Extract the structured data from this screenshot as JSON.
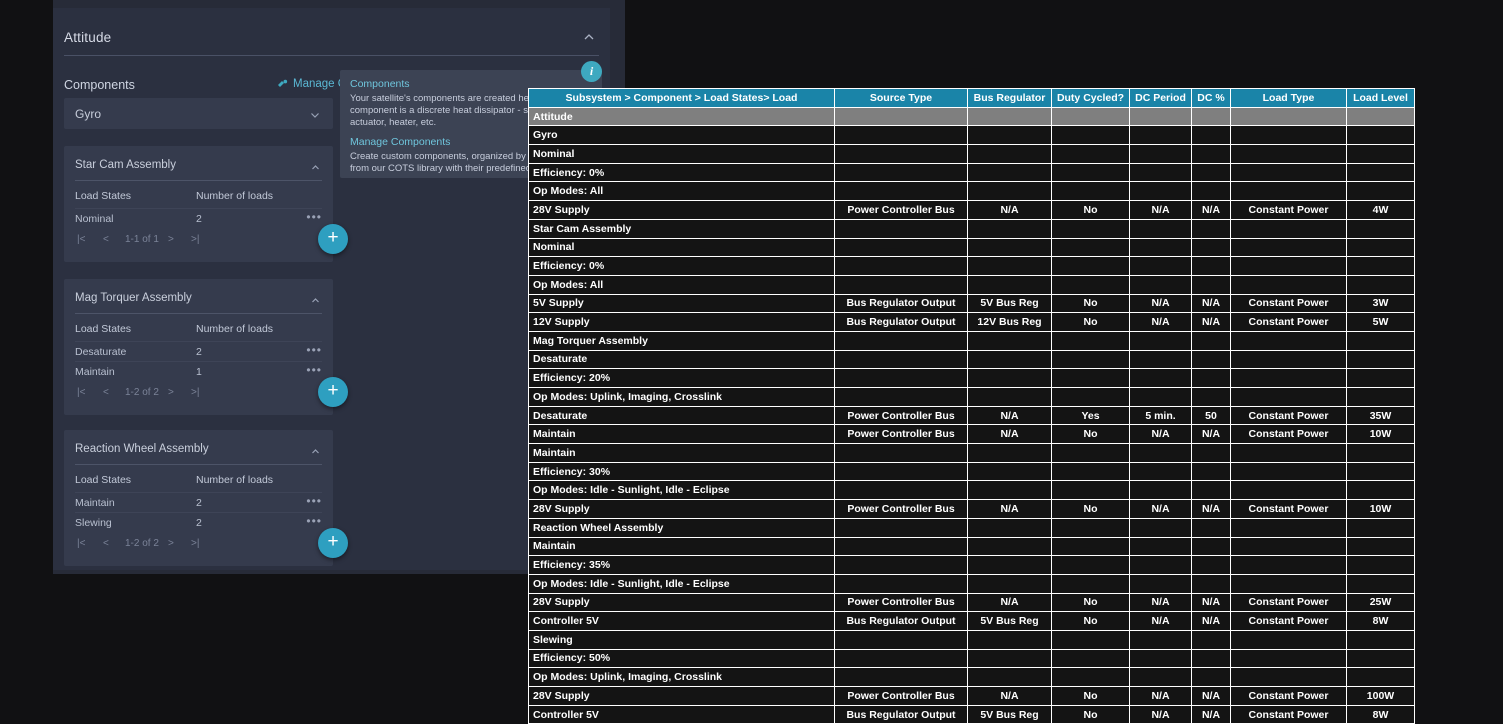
{
  "app": {
    "section_title": "Attitude",
    "components_label": "Components",
    "manage_components_link": "Manage Components",
    "selected_component": "Gyro",
    "load_states_header": "Load States",
    "number_of_loads_header": "Number of loads",
    "pager_first": "|<",
    "pager_prev": "<",
    "pager_next": ">",
    "pager_last": ">|",
    "add_label": "+",
    "more_label": "•••",
    "accent_color": "#2e9fc0",
    "link_color": "#5bb8d4",
    "assemblies": [
      {
        "title": "Star Cam Assembly",
        "pager_text": "1-1 of 1",
        "rows": [
          {
            "state": "Nominal",
            "loads": "2"
          }
        ]
      },
      {
        "title": "Mag Torquer Assembly",
        "pager_text": "1-2 of 2",
        "rows": [
          {
            "state": "Desaturate",
            "loads": "2"
          },
          {
            "state": "Maintain",
            "loads": "1"
          }
        ]
      },
      {
        "title": "Reaction Wheel Assembly",
        "pager_text": "1-2 of 2",
        "rows": [
          {
            "state": "Maintain",
            "loads": "2"
          },
          {
            "state": "Slewing",
            "loads": "2"
          }
        ]
      }
    ]
  },
  "tooltip": {
    "heading_1": "Components",
    "body_1": "Your satellite's components are created here. In Seda component is a discrete heat dissipator - such as a fl actuator, heater, etc.",
    "heading_2": "Manage Components",
    "body_2": "Create custom components, organized by subsystem from our COTS library with their predefined loads an"
  },
  "info_icon": {
    "glyph": "i"
  },
  "sheet": {
    "header_bg": "#1a84a8",
    "group_bg": "#7f7f7f",
    "columns": [
      "Subsystem > Component > Load States> Load",
      "Source Type",
      "Bus Regulator",
      "Duty Cycled?",
      "DC Period",
      "DC %",
      "Load Type",
      "Load Level"
    ],
    "rows": [
      {
        "group": true,
        "cells": [
          "Attitude",
          "",
          "",
          "",
          "",
          "",
          "",
          ""
        ]
      },
      {
        "group": false,
        "cells": [
          "Gyro",
          "",
          "",
          "",
          "",
          "",
          "",
          ""
        ]
      },
      {
        "group": false,
        "cells": [
          "Nominal",
          "",
          "",
          "",
          "",
          "",
          "",
          ""
        ]
      },
      {
        "group": false,
        "cells": [
          "Efficiency: 0%",
          "",
          "",
          "",
          "",
          "",
          "",
          ""
        ]
      },
      {
        "group": false,
        "cells": [
          "Op Modes: All",
          "",
          "",
          "",
          "",
          "",
          "",
          ""
        ]
      },
      {
        "group": false,
        "cells": [
          "28V Supply",
          "Power Controller Bus",
          "N/A",
          "No",
          "N/A",
          "N/A",
          "Constant Power",
          "4W"
        ]
      },
      {
        "group": false,
        "cells": [
          "Star Cam Assembly",
          "",
          "",
          "",
          "",
          "",
          "",
          ""
        ]
      },
      {
        "group": false,
        "cells": [
          "Nominal",
          "",
          "",
          "",
          "",
          "",
          "",
          ""
        ]
      },
      {
        "group": false,
        "cells": [
          "Efficiency: 0%",
          "",
          "",
          "",
          "",
          "",
          "",
          ""
        ]
      },
      {
        "group": false,
        "cells": [
          "Op Modes: All",
          "",
          "",
          "",
          "",
          "",
          "",
          ""
        ]
      },
      {
        "group": false,
        "cells": [
          "5V Supply",
          "Bus Regulator Output",
          "5V Bus Reg",
          "No",
          "N/A",
          "N/A",
          "Constant Power",
          "3W"
        ]
      },
      {
        "group": false,
        "cells": [
          "12V Supply",
          "Bus Regulator Output",
          "12V Bus Reg",
          "No",
          "N/A",
          "N/A",
          "Constant Power",
          "5W"
        ]
      },
      {
        "group": false,
        "cells": [
          "Mag Torquer Assembly",
          "",
          "",
          "",
          "",
          "",
          "",
          ""
        ]
      },
      {
        "group": false,
        "cells": [
          "Desaturate",
          "",
          "",
          "",
          "",
          "",
          "",
          ""
        ]
      },
      {
        "group": false,
        "cells": [
          "Efficiency: 20%",
          "",
          "",
          "",
          "",
          "",
          "",
          ""
        ]
      },
      {
        "group": false,
        "cells": [
          "Op Modes: Uplink, Imaging, Crosslink",
          "",
          "",
          "",
          "",
          "",
          "",
          ""
        ]
      },
      {
        "group": false,
        "cells": [
          "Desaturate",
          "Power Controller Bus",
          "N/A",
          "Yes",
          "5 min.",
          "50",
          "Constant Power",
          "35W"
        ]
      },
      {
        "group": false,
        "cells": [
          "Maintain",
          "Power Controller Bus",
          "N/A",
          "No",
          "N/A",
          "N/A",
          "Constant Power",
          "10W"
        ]
      },
      {
        "group": false,
        "cells": [
          "Maintain",
          "",
          "",
          "",
          "",
          "",
          "",
          ""
        ]
      },
      {
        "group": false,
        "cells": [
          "Efficiency: 30%",
          "",
          "",
          "",
          "",
          "",
          "",
          ""
        ]
      },
      {
        "group": false,
        "cells": [
          "Op Modes: Idle - Sunlight, Idle - Eclipse",
          "",
          "",
          "",
          "",
          "",
          "",
          ""
        ]
      },
      {
        "group": false,
        "cells": [
          "28V Supply",
          "Power Controller Bus",
          "N/A",
          "No",
          "N/A",
          "N/A",
          "Constant Power",
          "10W"
        ]
      },
      {
        "group": false,
        "cells": [
          "Reaction Wheel Assembly",
          "",
          "",
          "",
          "",
          "",
          "",
          ""
        ]
      },
      {
        "group": false,
        "cells": [
          "Maintain",
          "",
          "",
          "",
          "",
          "",
          "",
          ""
        ]
      },
      {
        "group": false,
        "cells": [
          "Efficiency: 35%",
          "",
          "",
          "",
          "",
          "",
          "",
          ""
        ]
      },
      {
        "group": false,
        "cells": [
          "Op Modes: Idle - Sunlight, Idle - Eclipse",
          "",
          "",
          "",
          "",
          "",
          "",
          ""
        ]
      },
      {
        "group": false,
        "cells": [
          "28V Supply",
          "Power Controller Bus",
          "N/A",
          "No",
          "N/A",
          "N/A",
          "Constant Power",
          "25W"
        ]
      },
      {
        "group": false,
        "cells": [
          "Controller 5V",
          "Bus Regulator Output",
          "5V Bus Reg",
          "No",
          "N/A",
          "N/A",
          "Constant Power",
          "8W"
        ]
      },
      {
        "group": false,
        "cells": [
          "Slewing",
          "",
          "",
          "",
          "",
          "",
          "",
          ""
        ]
      },
      {
        "group": false,
        "cells": [
          "Efficiency: 50%",
          "",
          "",
          "",
          "",
          "",
          "",
          ""
        ]
      },
      {
        "group": false,
        "cells": [
          "Op Modes: Uplink, Imaging, Crosslink",
          "",
          "",
          "",
          "",
          "",
          "",
          ""
        ]
      },
      {
        "group": false,
        "cells": [
          "28V Supply",
          "Power Controller Bus",
          "N/A",
          "No",
          "N/A",
          "N/A",
          "Constant Power",
          "100W"
        ]
      },
      {
        "group": false,
        "cells": [
          "Controller 5V",
          "Bus Regulator Output",
          "5V Bus Reg",
          "No",
          "N/A",
          "N/A",
          "Constant Power",
          "8W"
        ]
      }
    ]
  }
}
